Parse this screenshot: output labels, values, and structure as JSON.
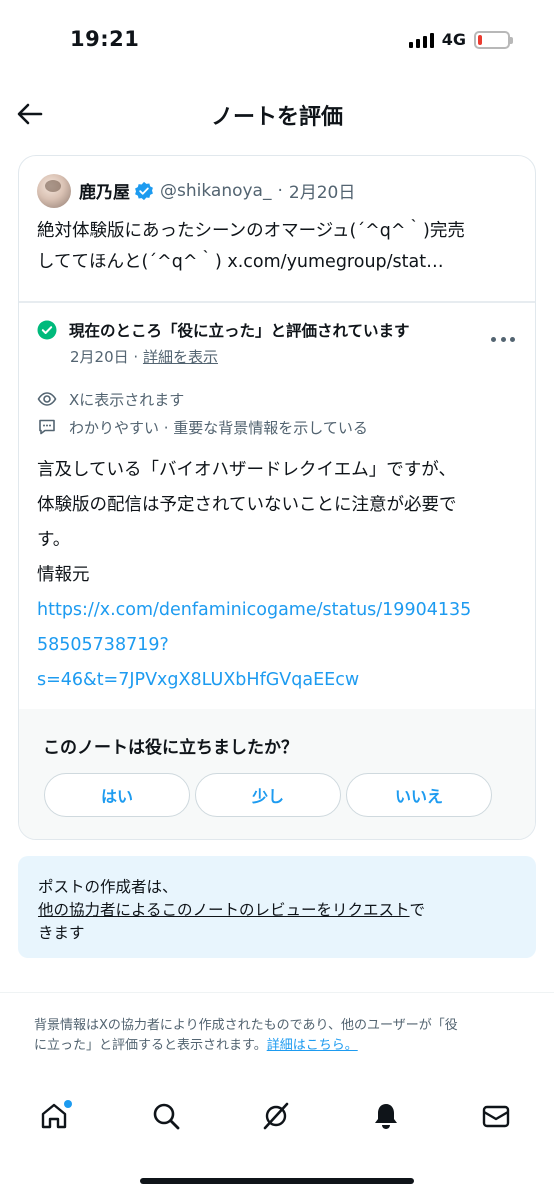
{
  "status_bar": {
    "time": "19:21",
    "network": "4G",
    "battery_level": 0.15
  },
  "header": {
    "title": "ノートを評価"
  },
  "post": {
    "author_name": "鹿乃屋",
    "handle": "@shikanoya_",
    "separator": "·",
    "date": "2月20日",
    "text_lines": [
      "絶対体験版にあったシーンのオマージュ(´^q^｀)完売",
      "しててほんと(´^q^｀) x.com/yumegroup/stat…"
    ]
  },
  "note": {
    "status": "現在のところ「役に立った」と評価されています",
    "date": "2月20日",
    "meta_separator": " · ",
    "details_link": "詳細を表示",
    "shown_on_x": "Xに表示されます",
    "reasons": "わかりやすい · 重要な背景情報を示している",
    "body_lines": [
      "言及している「バイオハザードレクイエム」ですが、",
      "体験版の配信は予定されていないことに注意が必要で",
      "す。",
      "情報元"
    ],
    "source_url_lines": [
      "https://x.com/denfaminicogame/status/19904135",
      "58505738719?",
      "s=46&t=7JPVxgX8LUXbHfGVqaEEcw"
    ]
  },
  "helpful": {
    "question": "このノートは役に立ちましたか？",
    "buttons": [
      "はい",
      "少し",
      "いいえ"
    ]
  },
  "request": {
    "line1": "ポストの作成者は、",
    "link_text": "他の協力者によるこのノートのレビューをリクエスト",
    "line2_tail": "で",
    "line3": "きます"
  },
  "footer": {
    "line1": "背景情報はXの協力者により作成されたものであり、他のユーザーが「役",
    "line2": "に立った」と評価すると表示されます。",
    "link": "詳細はこちら。"
  },
  "nav": {
    "items": [
      "home-icon",
      "search-icon",
      "grok-icon",
      "notifications-icon",
      "messages-icon"
    ],
    "accent": "#1d9bf0"
  }
}
